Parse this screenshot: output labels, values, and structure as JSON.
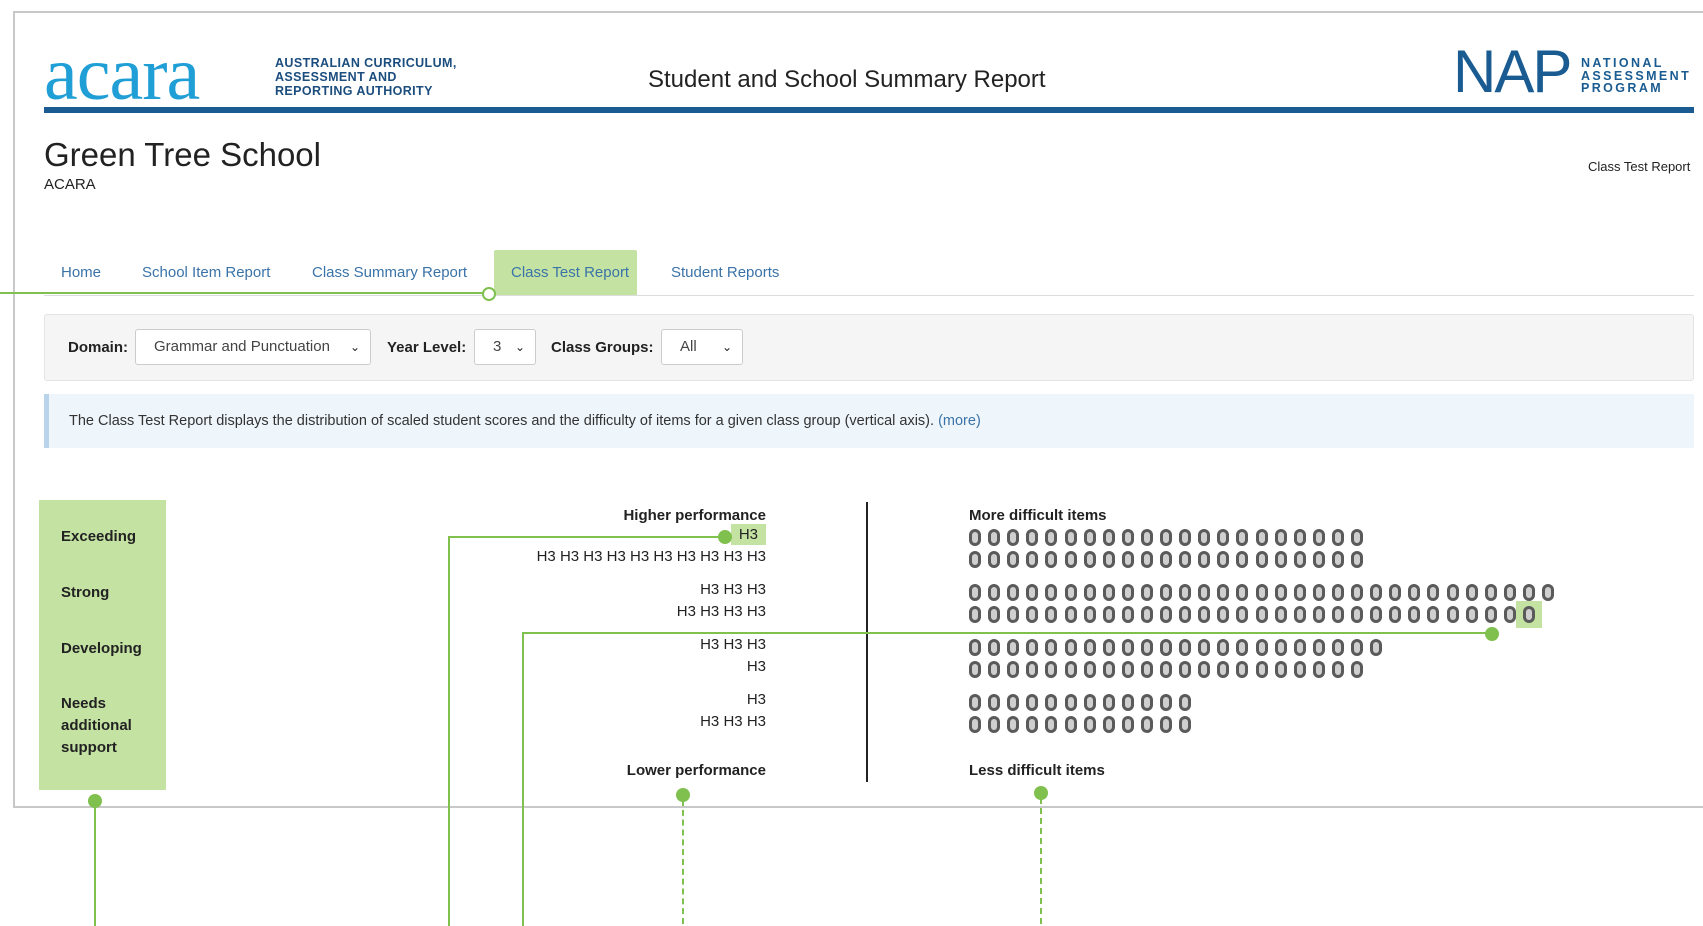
{
  "header": {
    "acara_logo": "acara",
    "acara_subtitle": [
      "AUSTRALIAN CURRICULUM,",
      "ASSESSMENT AND",
      "REPORTING AUTHORITY"
    ],
    "report_title": "Student and School Summary Report",
    "nap_logo": "NAP",
    "nap_subtitle": [
      "NATIONAL",
      "ASSESSMENT",
      "PROGRAM"
    ],
    "brand_color": "#1a5c91"
  },
  "school": {
    "name": "Green Tree School",
    "org": "ACARA",
    "current_page": "Class Test Report"
  },
  "tabs": [
    {
      "label": "Home",
      "active": false
    },
    {
      "label": "School Item Report",
      "active": false
    },
    {
      "label": "Class Summary Report",
      "active": false
    },
    {
      "label": "Class Test Report",
      "active": true
    },
    {
      "label": "Student Reports",
      "active": false
    }
  ],
  "filters": {
    "domain_label": "Domain:",
    "domain_value": "Grammar and Punctuation",
    "year_label": "Year Level:",
    "year_value": "3",
    "groups_label": "Class Groups:",
    "groups_value": "All"
  },
  "info": {
    "text": "The Class Test Report displays the distribution of scaled student scores and the difficulty of items for a given class group (vertical axis).",
    "more_link": "(more)"
  },
  "chart": {
    "bands": [
      "Exceeding",
      "Strong",
      "Developing",
      "Needs additional support"
    ],
    "left_top_title": "Higher performance",
    "left_bottom_title": "Lower performance",
    "right_top_title": "More difficult items",
    "right_bottom_title": "Less difficult items",
    "student_label": "H3",
    "student_rows": [
      1,
      10,
      3,
      4,
      3,
      1,
      1,
      3
    ],
    "highlighted_student_row": 0,
    "item_rows": [
      21,
      21,
      31,
      30,
      22,
      21,
      12,
      12
    ],
    "highlighted_item_row": 3,
    "highlight_color": "#c4e3a3",
    "callout_color": "#7fc04f"
  }
}
